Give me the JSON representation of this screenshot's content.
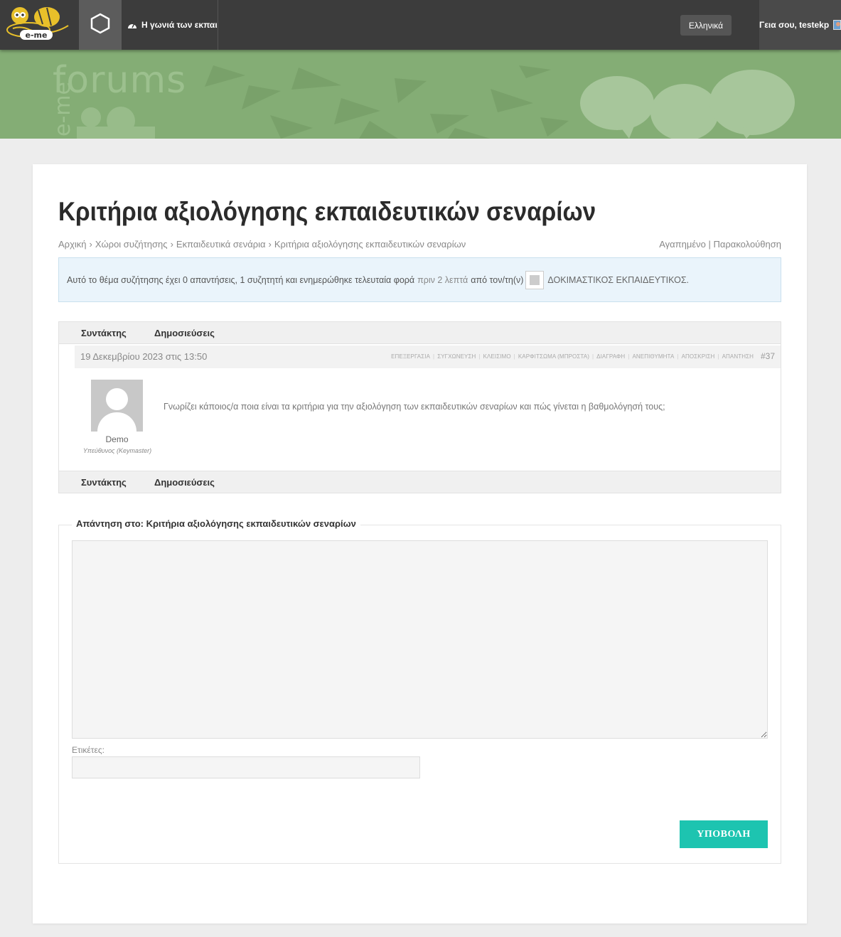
{
  "topbar": {
    "space_title": "Η γωνιά των εκπαι...",
    "language_label": "Ελληνικά",
    "greeting": "Γεια σου, testekp",
    "logo_text": "e-me"
  },
  "banner": {
    "text": "forums",
    "sub_text": "e-me"
  },
  "page": {
    "title": "Κριτήρια αξιολόγησης εκπαιδευτικών σεναρίων"
  },
  "breadcrumb": {
    "items": [
      "Αρχική",
      "Χώροι συζήτησης",
      "Εκπαιδευτικά σενάρια",
      "Κριτήρια αξιολόγησης εκπαιδευτικών σεναρίων"
    ],
    "separator": "›"
  },
  "topic_actions": {
    "favorite": "Αγαπημένο",
    "divider": "|",
    "subscribe": "Παρακολούθηση"
  },
  "notice": {
    "text": "Αυτό το θέμα συζήτησης έχει 0 απαντήσεις, 1 συζητητή και ενημερώθηκε τελευταία φορά",
    "freshness": "πριν 2 λεπτά",
    "by": "από τον/τη(ν)",
    "author": "ΔΟΚΙΜΑΣΤΙΚΟΣ ΕΚΠΑΙΔΕΥΤΙΚΟΣ."
  },
  "table": {
    "col_author": "Συντάκτης",
    "col_posts": "Δημοσιεύσεις"
  },
  "post": {
    "date": "19 Δεκεμβρίου 2023 στις 13:50",
    "actions": [
      "ΕΠΕΞΕΡΓΑΣΙΑ",
      "ΣΥΓΧΩΝΕΥΣΗ",
      "ΚΛΕΙΣΙΜΟ",
      "ΚΑΡΦΙΤΣΩΜΑ (ΜΠΡΟΣΤΑ)",
      "ΔΙΑΓΡΑΦΗ",
      "ΑΝΕΠΙΘΥΜΗΤΑ",
      "ΑΠΟΣΚΡΙΣΗ",
      "ΑΠΑΝΤΗΣΗ"
    ],
    "number": "#37",
    "author_name": "Demo",
    "author_role": "Υπεύθυνος (Keymaster)",
    "content": "Γνωρίζει κάποιος/α ποια είναι τα κριτήρια για την αξιολόγηση των εκπαιδευτικών σεναρίων και πώς γίνεται η βαθμολόγησή τους;"
  },
  "reply": {
    "legend": "Απάντηση στο: Κριτήρια αξιολόγησης εκπαιδευτικών σεναρίων",
    "textarea_value": "",
    "tags_label": "Ετικέτες:",
    "tags_value": "",
    "submit_label": "ΥΠΟΒΟΛΗ"
  },
  "colors": {
    "topbar_bg": "#3c3c3c",
    "banner_bg": "#84ad75",
    "submit_bg": "#1dc4b0",
    "notice_bg": "#eaf4fb",
    "logo_yellow": "#e8c02a"
  }
}
